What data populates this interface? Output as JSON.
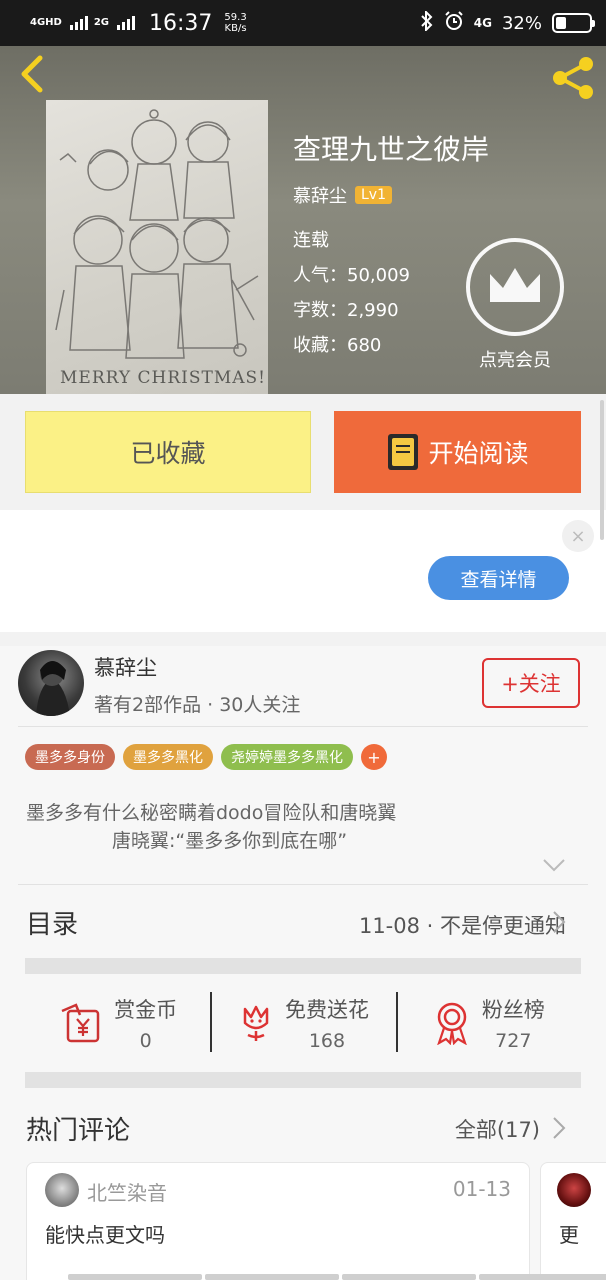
{
  "status_bar": {
    "network1": "4GHD",
    "network2": "2G",
    "time": "16:37",
    "speed_value": "59.3",
    "speed_unit": "KB/s",
    "network3": "4G",
    "battery": "32%",
    "battery_level": 0.32,
    "bluetooth_icon": "bluetooth-icon",
    "alarm_icon": "alarm-icon"
  },
  "book": {
    "title": "查理九世之彼岸",
    "author": "慕辞尘",
    "level": "Lv1",
    "status": "连载",
    "popularity": "人气：50,009",
    "word_count": "字数：2,990",
    "favorites": "收藏：680",
    "cover_caption": "MERRY CHRISTMAS!"
  },
  "vip": {
    "label": "点亮会员",
    "icon": "crown-icon"
  },
  "actions": {
    "collect_label": "已收藏",
    "read_label": "开始阅读",
    "read_icon": "book-icon"
  },
  "ad": {
    "detail_label": "查看详情",
    "close_symbol": "×"
  },
  "author_section": {
    "name": "慕辞尘",
    "meta": "著有2部作品 · 30人关注",
    "follow_label": "+关注"
  },
  "tags": [
    {
      "label": "墨多多身份",
      "color": "#c86a52"
    },
    {
      "label": "墨多多黑化",
      "color": "#e0a23e"
    },
    {
      "label": "尧婷婷墨多多黑化",
      "color": "#8fbe4e"
    }
  ],
  "tag_add_label": "+",
  "description": {
    "line1": "墨多多有什么秘密瞒着dodo冒险队和唐晓翼",
    "line2": "唐晓翼:“墨多多你到底在哪”"
  },
  "toc": {
    "title": "目录",
    "latest": "11-08 · 不是停更通知"
  },
  "stats": [
    {
      "label": "赏金币",
      "value": "0",
      "icon": "coin-envelope-icon"
    },
    {
      "label": "免费送花",
      "value": "168",
      "icon": "flower-icon"
    },
    {
      "label": "粉丝榜",
      "value": "727",
      "icon": "medal-icon"
    }
  ],
  "comments": {
    "title": "热门评论",
    "all_label": "全部(17)",
    "items": [
      {
        "user": "北竺染音",
        "date": "01-13",
        "text": "能快点更文吗"
      },
      {
        "user": "",
        "date": "",
        "text": "更"
      }
    ]
  },
  "colors": {
    "accent_orange": "#ef6a3b",
    "collect_yellow": "#fbf186",
    "follow_red": "#dd3333",
    "detail_blue": "#4a90e2"
  }
}
